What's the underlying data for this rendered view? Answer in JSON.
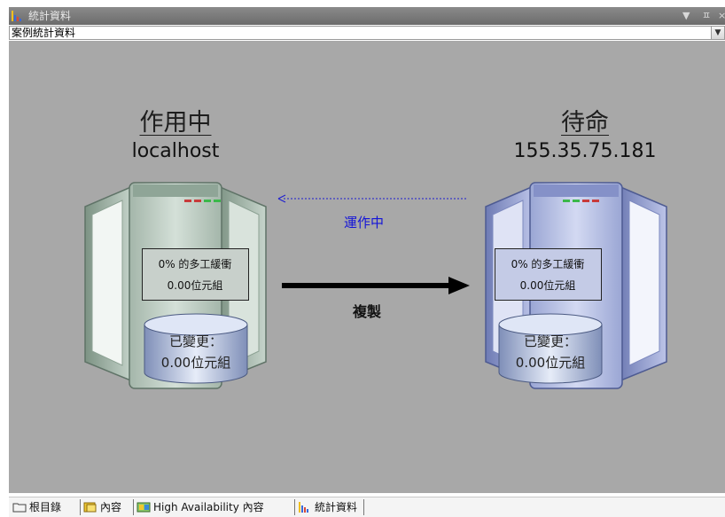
{
  "window": {
    "title": "統計資料"
  },
  "selector": {
    "value": "案例統計資料"
  },
  "active": {
    "title": "作用中",
    "host": "localhost",
    "stats_line1": "0% 的多工緩衝",
    "stats_line2": "0.00位元組",
    "disk_line1": "已變更：",
    "disk_line2": "0.00位元組"
  },
  "standby": {
    "title": "待命",
    "host": "155.35.75.181",
    "stats_line1": "0% 的多工緩衝",
    "stats_line2": "0.00位元組",
    "disk_line1": "已變更：",
    "disk_line2": "0.00位元組"
  },
  "links": {
    "status": "運作中",
    "replication": "複製"
  },
  "tabs": [
    {
      "label": "根目錄",
      "icon": "folder-icon"
    },
    {
      "label": "內容",
      "icon": "properties-icon"
    },
    {
      "label": "High Availability 內容",
      "icon": "ha-properties-icon"
    },
    {
      "label": "統計資料",
      "icon": "statistics-icon"
    }
  ],
  "colors": {
    "canvas_bg": "#a8a8a8",
    "active_server": "#b8c8be",
    "standby_server": "#b6c0e6",
    "status_text": "#1414d8"
  }
}
